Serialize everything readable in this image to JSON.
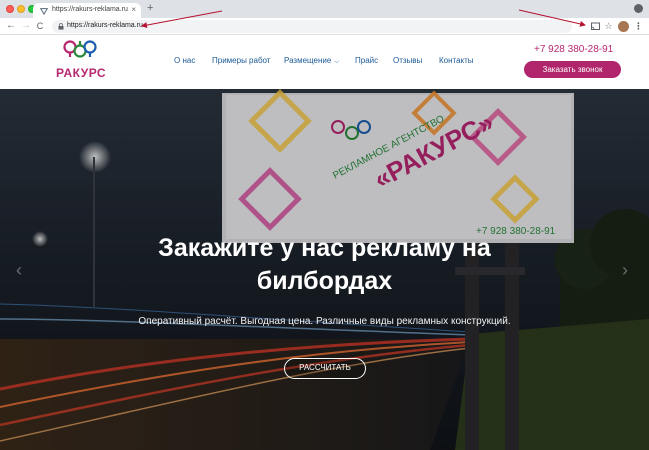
{
  "browser": {
    "tab_title": "https://rakurs-reklama.ru",
    "tab_close": "×",
    "new_tab": "+",
    "url": "https://rakurs-reklama.ru",
    "nav_back": "←",
    "nav_forward": "→",
    "reload": "C",
    "menu": "⋮"
  },
  "site": {
    "logo_text": "РАКУРС",
    "nav": [
      "О нас",
      "Примеры работ",
      "Размещение",
      "Прайс",
      "Отзывы",
      "Контакты"
    ],
    "phone": "+7 928 380-28-91",
    "callback_button": "Заказать звонок"
  },
  "hero": {
    "title": "Закажите у нас рекламу на билбордах",
    "subtitle": "Оперативный расчёт. Выгодная цена. Различные виды рекламных конструкций.",
    "button": "РАССЧИТАТЬ",
    "prev": "‹",
    "next": "›",
    "billboard": {
      "agency_line": "РЕКЛАМНОЕ АГЕНТСТВО",
      "brand": "«РАКУРС»",
      "phone": "+7 928 380-28-91"
    }
  },
  "colors": {
    "brand": "#b62771",
    "nav": "#1c5a96"
  },
  "icons": [
    "lock-icon",
    "cast-icon",
    "star-icon",
    "avatar",
    "menu-icon",
    "chevron-down-icon"
  ]
}
